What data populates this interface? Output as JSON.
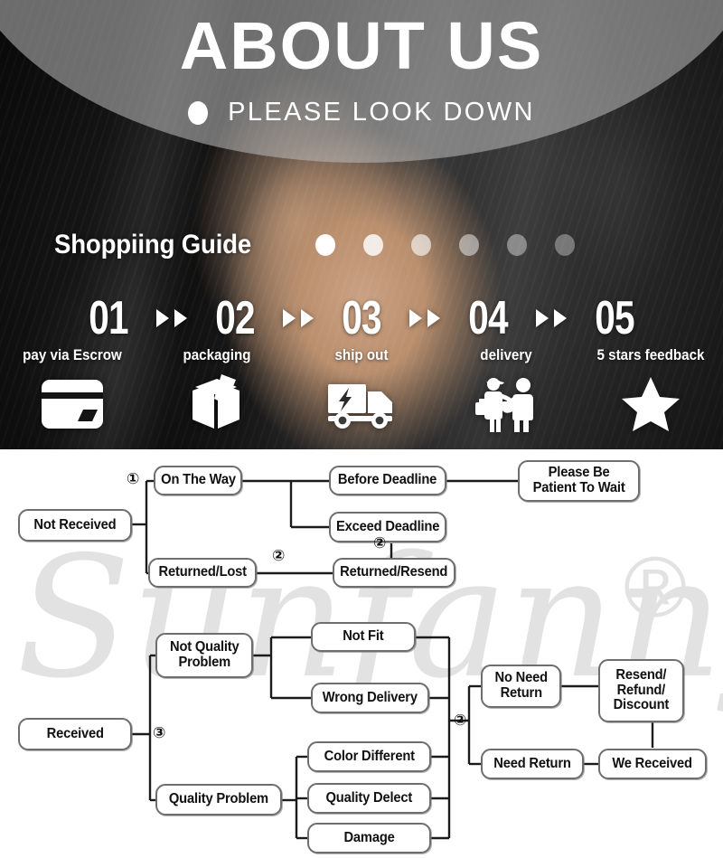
{
  "hero": {
    "title": "ABOUT US",
    "subtitle": "PLEASE LOOK DOWN",
    "bullet_icon": "circle-bullet-icon",
    "guide_title": "Shoppiing Guide",
    "guide_dots": 6,
    "steps": [
      {
        "number": "01",
        "label": "pay via Escrow",
        "icon": "credit-card-icon"
      },
      {
        "number": "02",
        "label": "packaging",
        "icon": "package-box-icon"
      },
      {
        "number": "03",
        "label": "ship out",
        "icon": "delivery-truck-icon"
      },
      {
        "number": "04",
        "label": "delivery",
        "icon": "handshake-delivery-icon"
      },
      {
        "number": "05",
        "label": "5 stars feedback",
        "icon": "star-icon"
      }
    ],
    "arrow_icon": "double-right-arrow-icon",
    "colors": {
      "text": "#ffffff",
      "background": "#141414",
      "overlay": "rgba(190,190,190,0.55)"
    }
  },
  "watermark": {
    "text": "Sunfanny",
    "registered_mark": "®",
    "color": "#e2e2e2"
  },
  "flowchart": {
    "colors": {
      "box_border": "#6e6e6e",
      "box_fill": "#ffffff",
      "line": "#1b1b1b",
      "text": "#111111"
    },
    "nodes": [
      {
        "id": "not_received",
        "label": "Not Received"
      },
      {
        "id": "on_the_way",
        "label": "On The Way"
      },
      {
        "id": "returned_lost",
        "label": "Returned/Lost"
      },
      {
        "id": "before_deadline",
        "label": "Before Deadline"
      },
      {
        "id": "exceed_deadline",
        "label": "Exceed Deadline"
      },
      {
        "id": "returned_resend",
        "label": "Returned/Resend"
      },
      {
        "id": "please_be_patient",
        "label": "Please Be\nPatient To Wait"
      },
      {
        "id": "received",
        "label": "Received"
      },
      {
        "id": "not_quality",
        "label": "Not Quality\nProblem"
      },
      {
        "id": "quality_problem",
        "label": "Quality Problem"
      },
      {
        "id": "not_fit",
        "label": "Not Fit"
      },
      {
        "id": "wrong_delivery",
        "label": "Wrong Delivery"
      },
      {
        "id": "color_different",
        "label": "Color Different"
      },
      {
        "id": "quality_delect",
        "label": "Quality Delect"
      },
      {
        "id": "damage",
        "label": "Damage"
      },
      {
        "id": "no_need_return",
        "label": "No Need\nReturn"
      },
      {
        "id": "need_return",
        "label": "Need Return"
      },
      {
        "id": "resend_refund",
        "label": "Resend/\nRefund/\nDiscount"
      },
      {
        "id": "we_received",
        "label": "We Received"
      }
    ],
    "markers": [
      {
        "id": "m1",
        "label": "①"
      },
      {
        "id": "m2",
        "label": "②"
      },
      {
        "id": "m3",
        "label": "②"
      },
      {
        "id": "m4",
        "label": "③"
      },
      {
        "id": "m5",
        "label": "②"
      }
    ]
  }
}
